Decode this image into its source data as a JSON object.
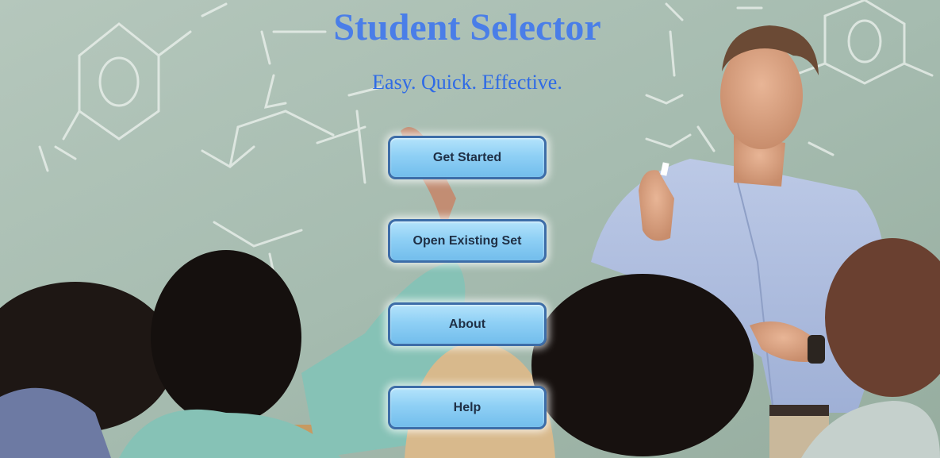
{
  "app": {
    "title": "Student Selector",
    "tagline": "Easy. Quick. Effective."
  },
  "menu": {
    "get_started": "Get Started",
    "open_existing_set": "Open Existing Set",
    "about": "About",
    "help": "Help"
  },
  "colors": {
    "title": "#4a7ee8",
    "tagline": "#2e6ae6",
    "button_fill": "#8fd0f5",
    "button_border": "#3d6da8",
    "button_text": "#1f2f45",
    "chalkboard": "#a9bfb3"
  },
  "background": {
    "scene": "classroom-photo"
  }
}
